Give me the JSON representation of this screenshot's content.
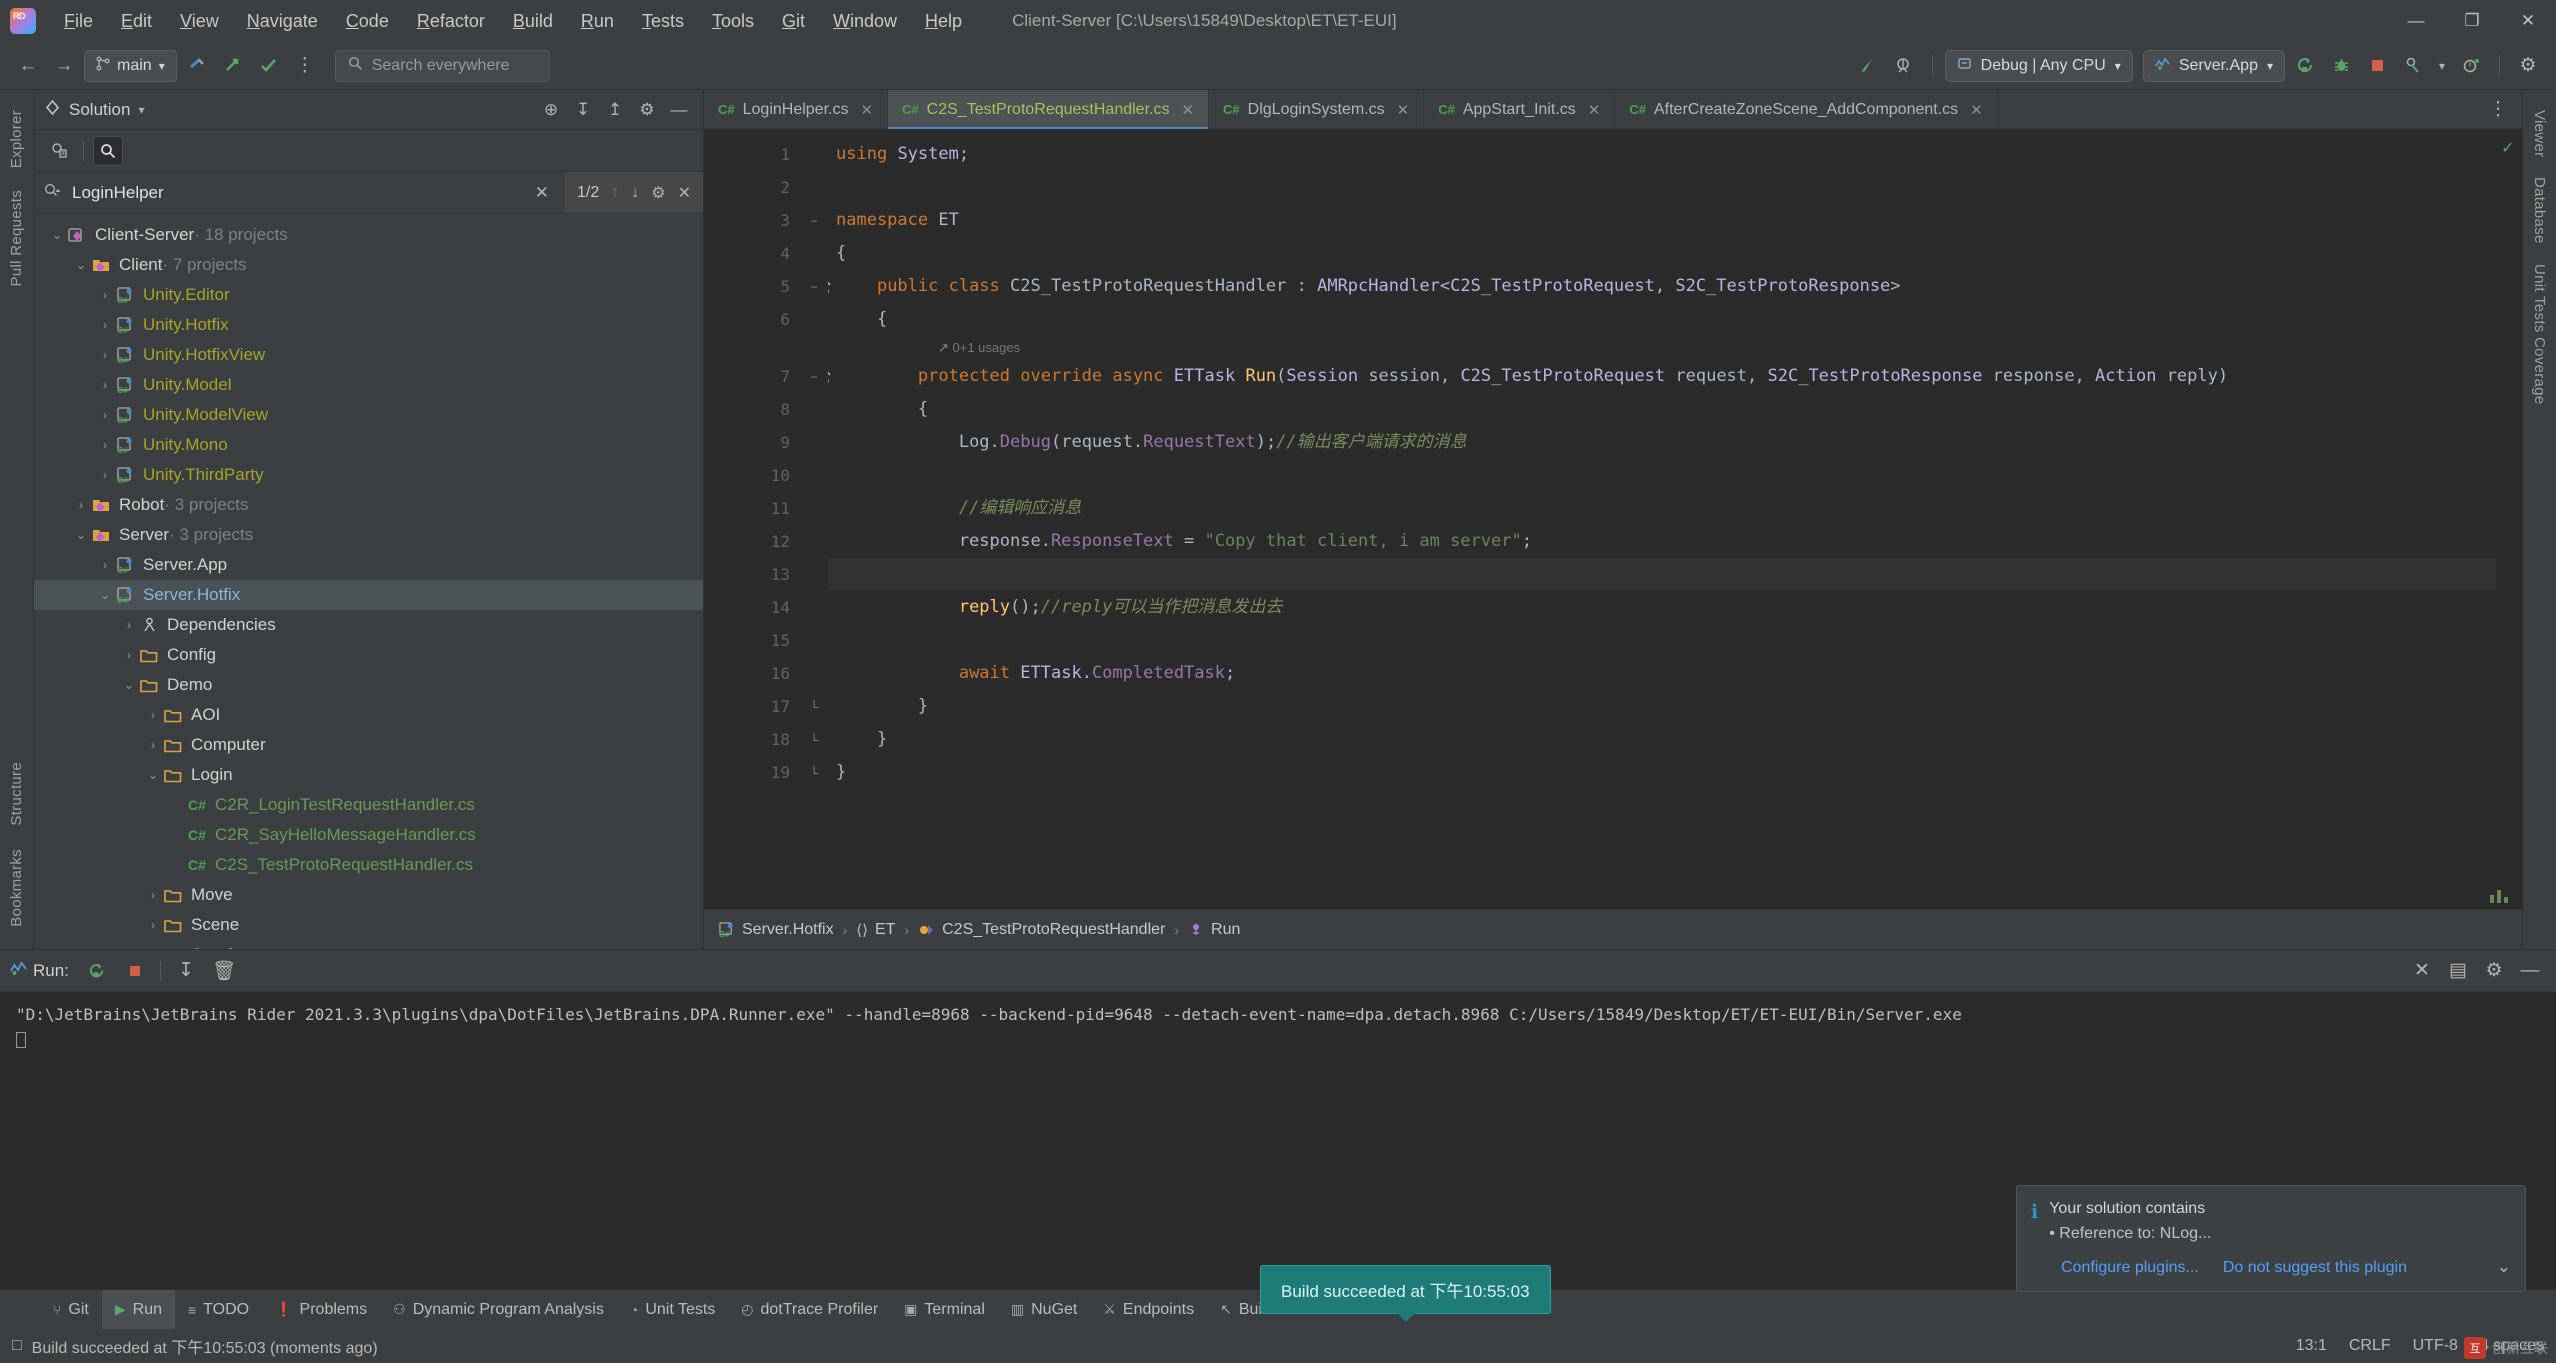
{
  "window": {
    "title": "Client-Server [C:\\Users\\15849\\Desktop\\ET\\ET-EUI]",
    "minimize": "—",
    "maximize": "❐",
    "close": "✕"
  },
  "menu": {
    "items": [
      {
        "label": "File",
        "mnemonic": "F",
        "rest": "ile"
      },
      {
        "label": "Edit",
        "mnemonic": "E",
        "rest": "dit"
      },
      {
        "label": "View",
        "mnemonic": "V",
        "rest": "iew"
      },
      {
        "label": "Navigate",
        "mnemonic": "N",
        "rest": "avigate"
      },
      {
        "label": "Code",
        "mnemonic": "C",
        "rest": "ode"
      },
      {
        "label": "Refactor",
        "mnemonic": "R",
        "rest": "efactor"
      },
      {
        "label": "Build",
        "mnemonic": "B",
        "rest": "uild"
      },
      {
        "label": "Run",
        "mnemonic": "R",
        "rest": "un"
      },
      {
        "label": "Tests",
        "mnemonic": "T",
        "rest": "ests"
      },
      {
        "label": "Tools",
        "mnemonic": "T",
        "rest": "ools"
      },
      {
        "label": "Git",
        "mnemonic": "G",
        "rest": "it"
      },
      {
        "label": "Window",
        "mnemonic": "W",
        "rest": "indow"
      },
      {
        "label": "Help",
        "mnemonic": "H",
        "rest": "elp"
      }
    ]
  },
  "toolbar": {
    "back_icon": "←",
    "forward_icon": "→",
    "branch": "main",
    "branch_caret": "▾",
    "search_everywhere": "Search everywhere",
    "search_icon": "⌕",
    "more_icon": "⋮",
    "build_icon": "✓",
    "run_arrow_icon": "↗",
    "check_icon": "✓",
    "hammer_icon": "↖",
    "settings_icon": "⚙",
    "configuration": "Debug | Any CPU",
    "run_config": "Server.App",
    "caret": "▾",
    "rerun_icon": "↻",
    "debug_icon": "🐞",
    "stop_icon": "■",
    "coverage_icon": "⚗",
    "profile_icon": "◴",
    "gear_icon": "⚙"
  },
  "left_strip": {
    "tabs": [
      "Explorer",
      "Pull Requests"
    ],
    "bottom_tabs": [
      "Structure",
      "Bookmarks"
    ]
  },
  "right_strip": {
    "tabs": [
      "Viewer",
      "Database",
      "Unit Tests Coverage"
    ]
  },
  "solution": {
    "title": "Solution",
    "caret": "▾",
    "header_icons": [
      "locate-icon",
      "expand-all-icon",
      "collapse-all-icon",
      "settings-icon",
      "hide-icon"
    ],
    "locate_icon": "⊕",
    "expand_icon": "↧",
    "collapse_icon": "↥",
    "settings_icon": "⚙",
    "hide_icon": "—",
    "scope_icon": "◔",
    "find_icon": "⌕",
    "search": {
      "value": "LoginHelper",
      "clear_icon": "✕",
      "match_count": "1/2",
      "prev_icon": "↑",
      "next_icon": "↓",
      "settings_icon": "⚙",
      "close_icon": "✕"
    },
    "tree": [
      {
        "depth": 0,
        "chev": "⌄",
        "icon": "solution",
        "label": "Client-Server",
        "suffix": " · 18 projects",
        "style": "norm"
      },
      {
        "depth": 1,
        "chev": "⌄",
        "icon": "solfolder",
        "label": "Client",
        "suffix": " · 7 projects",
        "style": "norm"
      },
      {
        "depth": 2,
        "chev": "›",
        "icon": "csproj",
        "label": "Unity.Editor",
        "suffix": "",
        "style": "unity"
      },
      {
        "depth": 2,
        "chev": "›",
        "icon": "csproj",
        "label": "Unity.Hotfix",
        "suffix": "",
        "style": "unity"
      },
      {
        "depth": 2,
        "chev": "›",
        "icon": "csproj",
        "label": "Unity.HotfixView",
        "suffix": "",
        "style": "unity"
      },
      {
        "depth": 2,
        "chev": "›",
        "icon": "csproj",
        "label": "Unity.Model",
        "suffix": "",
        "style": "unity"
      },
      {
        "depth": 2,
        "chev": "›",
        "icon": "csproj",
        "label": "Unity.ModelView",
        "suffix": "",
        "style": "unity"
      },
      {
        "depth": 2,
        "chev": "›",
        "icon": "csproj",
        "label": "Unity.Mono",
        "suffix": "",
        "style": "unity"
      },
      {
        "depth": 2,
        "chev": "›",
        "icon": "csproj",
        "label": "Unity.ThirdParty",
        "suffix": "",
        "style": "unity"
      },
      {
        "depth": 1,
        "chev": "›",
        "icon": "solfolder",
        "label": "Robot",
        "suffix": " · 3 projects",
        "style": "norm"
      },
      {
        "depth": 1,
        "chev": "⌄",
        "icon": "solfolder",
        "label": "Server",
        "suffix": " · 3 projects",
        "style": "norm"
      },
      {
        "depth": 2,
        "chev": "›",
        "icon": "csproj",
        "label": "Server.App",
        "suffix": "",
        "style": "norm"
      },
      {
        "depth": 2,
        "chev": "⌄",
        "icon": "csproj",
        "label": "Server.Hotfix",
        "suffix": "",
        "style": "selected",
        "selected": true
      },
      {
        "depth": 3,
        "chev": "›",
        "icon": "deps",
        "label": "Dependencies",
        "suffix": "",
        "style": "norm"
      },
      {
        "depth": 3,
        "chev": "›",
        "icon": "folder",
        "label": "Config",
        "suffix": "",
        "style": "norm"
      },
      {
        "depth": 3,
        "chev": "⌄",
        "icon": "folder",
        "label": "Demo",
        "suffix": "",
        "style": "norm"
      },
      {
        "depth": 4,
        "chev": "›",
        "icon": "folder",
        "label": "AOI",
        "suffix": "",
        "style": "norm"
      },
      {
        "depth": 4,
        "chev": "›",
        "icon": "folder",
        "label": "Computer",
        "suffix": "",
        "style": "norm"
      },
      {
        "depth": 4,
        "chev": "⌄",
        "icon": "folder",
        "label": "Login",
        "suffix": "",
        "style": "norm"
      },
      {
        "depth": 5,
        "chev": "",
        "icon": "cs",
        "label": "C2R_LoginTestRequestHandler.cs",
        "suffix": "",
        "style": "cs"
      },
      {
        "depth": 5,
        "chev": "",
        "icon": "cs",
        "label": "C2R_SayHelloMessageHandler.cs",
        "suffix": "",
        "style": "cs"
      },
      {
        "depth": 5,
        "chev": "",
        "icon": "cs",
        "label": "C2S_TestProtoRequestHandler.cs",
        "suffix": "",
        "style": "cs"
      },
      {
        "depth": 4,
        "chev": "›",
        "icon": "folder",
        "label": "Move",
        "suffix": "",
        "style": "norm"
      },
      {
        "depth": 4,
        "chev": "›",
        "icon": "folder",
        "label": "Scene",
        "suffix": "",
        "style": "norm"
      },
      {
        "depth": 4,
        "chev": "›",
        "icon": "folder",
        "label": "Session",
        "suffix": "",
        "style": "norm"
      }
    ]
  },
  "editor": {
    "tabs": [
      {
        "label": "LoginHelper.cs",
        "active": false
      },
      {
        "label": "C2S_TestProtoRequestHandler.cs",
        "active": true
      },
      {
        "label": "DlgLoginSystem.cs",
        "active": false
      },
      {
        "label": "AppStart_Init.cs",
        "active": false
      },
      {
        "label": "AfterCreateZoneScene_AddComponent.cs",
        "active": false
      }
    ],
    "tab_close_icon": "✕",
    "tab_cs_badge": "C#",
    "tabs_more_icon": "⋮",
    "status_ok_icon": "✓",
    "usage_hint": "0+1 usages",
    "usage_icon": "↗",
    "lines": [
      {
        "n": 1,
        "fold": "",
        "marker": ""
      },
      {
        "n": 2,
        "fold": "",
        "marker": ""
      },
      {
        "n": 3,
        "fold": "−",
        "marker": ""
      },
      {
        "n": 4,
        "fold": "",
        "marker": ""
      },
      {
        "n": 5,
        "fold": "−",
        "marker": "impl"
      },
      {
        "n": 6,
        "fold": "",
        "marker": ""
      },
      {
        "n": 7,
        "fold": "−",
        "marker": "override"
      },
      {
        "n": 8,
        "fold": "",
        "marker": ""
      },
      {
        "n": 9,
        "fold": "",
        "marker": ""
      },
      {
        "n": 10,
        "fold": "",
        "marker": ""
      },
      {
        "n": 11,
        "fold": "",
        "marker": ""
      },
      {
        "n": 12,
        "fold": "",
        "marker": ""
      },
      {
        "n": 13,
        "fold": "",
        "marker": "",
        "current": true
      },
      {
        "n": 14,
        "fold": "",
        "marker": ""
      },
      {
        "n": 15,
        "fold": "",
        "marker": ""
      },
      {
        "n": 16,
        "fold": "",
        "marker": ""
      },
      {
        "n": 17,
        "fold": "└",
        "marker": ""
      },
      {
        "n": 18,
        "fold": "└",
        "marker": ""
      },
      {
        "n": 19,
        "fold": "└",
        "marker": ""
      }
    ],
    "code_text": {
      "l1": "using System;",
      "l3": "namespace ET",
      "l4": "{",
      "l5": "public class C2S_TestProtoRequestHandler : AMRpcHandler<C2S_TestProtoRequest, S2C_TestProtoResponse>",
      "l6": "{",
      "l7": "protected override async ETTask Run(Session session, C2S_TestProtoRequest request, S2C_TestProtoResponse response, Action reply)",
      "l8": "{",
      "l9": "Log.Debug(request.RequestText);//输出客户端请求的消息",
      "l11": "//编辑响应消息",
      "l12": "response.ResponseText = \"Copy that client, i am server\";",
      "l14": "reply();//reply可以当作把消息发出去",
      "l16": "await ETTask.CompletedTask;",
      "l17": "}",
      "l18": "}",
      "l19": "}"
    },
    "breadcrumbs": [
      {
        "label": "Server.Hotfix",
        "icon": "csproj-icon"
      },
      {
        "label": "ET",
        "icon": "namespace-icon"
      },
      {
        "label": "C2S_TestProtoRequestHandler",
        "icon": "class-icon"
      },
      {
        "label": "Run",
        "icon": "method-icon"
      }
    ],
    "breadcrumb_sep": "›"
  },
  "run_panel": {
    "title": "Run:",
    "rerun_icon": "↻",
    "stop_icon": "■",
    "scroll_end_icon": "↧",
    "trash_icon": "🗑",
    "close_icon": "✕",
    "layout_icon": "▤",
    "settings_icon": "⚙",
    "minimize_icon": "—",
    "console_text": "\"D:\\JetBrains\\JetBrains Rider 2021.3.3\\plugins\\dpa\\DotFiles\\JetBrains.DPA.Runner.exe\" --handle=8968 --backend-pid=9648 --detach-event-name=dpa.detach.8968 C:/Users/15849/Desktop/ET/ET-EUI/Bin/Server.exe"
  },
  "bottom_tabs": [
    {
      "label": "Git",
      "icon": "⑂",
      "active": false
    },
    {
      "label": "Run",
      "icon": "▶",
      "active": true
    },
    {
      "label": "TODO",
      "icon": "≡",
      "active": false
    },
    {
      "label": "Problems",
      "icon": "❗",
      "active": false
    },
    {
      "label": "Dynamic Program Analysis",
      "icon": "⚇",
      "active": false
    },
    {
      "label": "Unit Tests",
      "icon": "◔",
      "active": false
    },
    {
      "label": "dotTrace Profiler",
      "icon": "◴",
      "active": false
    },
    {
      "label": "Terminal",
      "icon": "▣",
      "active": false
    },
    {
      "label": "NuGet",
      "icon": "▥",
      "active": false
    },
    {
      "label": "Endpoints",
      "icon": "⚔",
      "active": false
    },
    {
      "label": "Build",
      "icon": "↖",
      "active": false
    }
  ],
  "statusbar": {
    "message_icon": "□",
    "message": "Build succeeded at 下午10:55:03 (moments ago)",
    "caret_position": "13:1",
    "line_separator": "CRLF",
    "encoding": "UTF-8",
    "indent": "4 spaces"
  },
  "build_toast": {
    "text": "Build succeeded at 下午10:55:03"
  },
  "notification": {
    "info_icon": "ℹ",
    "title": "Your solution contains",
    "bullet": "• Reference to: NLog...",
    "link_configure": "Configure plugins...",
    "link_dismiss": "Do not suggest this plugin",
    "chevron": "⌄"
  },
  "watermark": {
    "badge": "互",
    "text": "创新互联"
  }
}
